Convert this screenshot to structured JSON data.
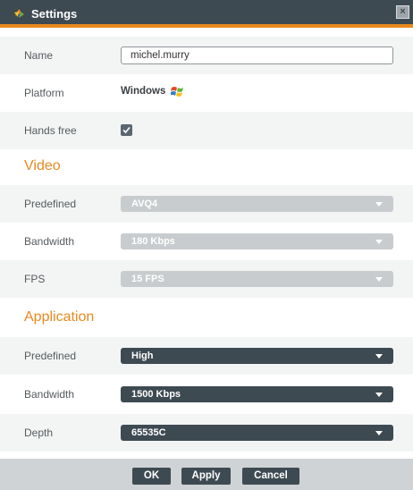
{
  "window": {
    "title": "Settings",
    "close_symbol": "×"
  },
  "fields": {
    "name": {
      "label": "Name",
      "value": "michel.murry"
    },
    "platform": {
      "label": "Platform",
      "value": "Windows",
      "icon": "windows-logo-icon"
    },
    "hands_free": {
      "label": "Hands free",
      "checked": true
    }
  },
  "video": {
    "title": "Video",
    "predefined": {
      "label": "Predefined",
      "value": "AVQ4",
      "disabled": true
    },
    "bandwidth": {
      "label": "Bandwidth",
      "value": "180 Kbps",
      "disabled": true
    },
    "fps": {
      "label": "FPS",
      "value": "15 FPS",
      "disabled": true
    }
  },
  "application": {
    "title": "Application",
    "predefined": {
      "label": "Predefined",
      "value": "High"
    },
    "bandwidth": {
      "label": "Bandwidth",
      "value": "1500 Kbps"
    },
    "depth": {
      "label": "Depth",
      "value": "65535C"
    }
  },
  "buttons": {
    "ok": "OK",
    "apply": "Apply",
    "cancel": "Cancel"
  },
  "colors": {
    "titlebar": "#3e4a52",
    "accent": "#e8891e",
    "disabled_select": "#c8ccce",
    "footer": "#cfd3d5"
  }
}
